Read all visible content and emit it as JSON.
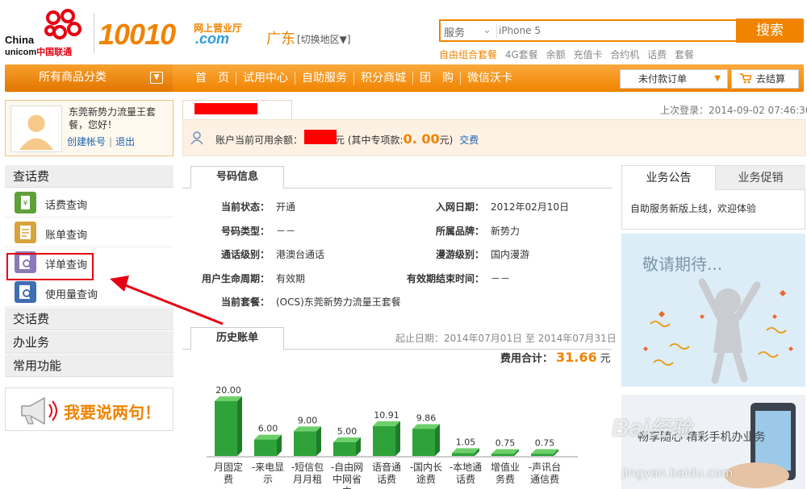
{
  "header": {
    "logo_text_1": "China",
    "logo_text_2a": "unicom",
    "logo_text_2b": "中国联通",
    "brand_number": "10010",
    "brand_hall": "网上营业厅",
    "brand_com": ".com",
    "region": "广东",
    "region_switch": "[切换地区▼]",
    "search": {
      "category": "服务",
      "placeholder": "iPhone 5",
      "button": "搜索",
      "hot_links": [
        "自由组合套餐",
        "4G套餐",
        "余额",
        "充值卡",
        "合约机",
        "话费",
        "套餐"
      ]
    }
  },
  "nav": {
    "all_categories": "所有商品分类",
    "items": [
      "首　页",
      "试用中心",
      "自助服务",
      "积分商城",
      "团　购",
      "微信沃卡"
    ],
    "unpaid_orders": "未付款订单",
    "checkout": "去结算"
  },
  "user": {
    "name": "东莞新势力流量王套餐，您好！",
    "create_account": "创建帐号",
    "logout": "退出"
  },
  "sidebar": {
    "sections": [
      {
        "title": "查话费",
        "items": [
          "话费查询",
          "账单查询",
          "详单查询",
          "使用量查询"
        ]
      },
      {
        "title": "交话费"
      },
      {
        "title": "办业务"
      },
      {
        "title": "常用功能"
      }
    ],
    "speak": "我要说两句！"
  },
  "account": {
    "last_login": "上次登录：2014-09-02 07:46:30",
    "balance_prefix": "账户当前可用余额：",
    "balance_suffix": "元 (其中专项款:",
    "special_amount": "0. 00",
    "balance_end": "元)",
    "pay_link": "交费"
  },
  "number_info": {
    "tab": "号码信息",
    "rows": [
      {
        "k": "当前状态：",
        "v": "开通"
      },
      {
        "k": "入网日期：",
        "v": "2012年02月10日"
      },
      {
        "k": "号码类型：",
        "v": "－－"
      },
      {
        "k": "所属品牌：",
        "v": "新势力"
      },
      {
        "k": "通话级别：",
        "v": "港澳台通话"
      },
      {
        "k": "漫游级别：",
        "v": "国内漫游"
      },
      {
        "k": "用户生命周期：",
        "v": "有效期"
      },
      {
        "k": "有效期结束时间：",
        "v": "－－"
      },
      {
        "k": "当前套餐：",
        "v": "(OCS)东莞新势力流量王套餐"
      }
    ]
  },
  "bill_history": {
    "tab": "历史账单",
    "period": "起止日期：2014年07月01日 至 2014年07月31日",
    "total_label": "费用合计：",
    "total_amount": "31.66",
    "total_unit": "元"
  },
  "chart_data": {
    "type": "bar",
    "categories": [
      "月固定费",
      "-来电显示",
      "-短信包月月租",
      "-自由网中网省内",
      "语音通话费",
      "-国内长途费",
      "-本地通话费",
      "增值业务费",
      "-声讯台通信费"
    ],
    "category_lines": [
      [
        "月固定",
        "费"
      ],
      [
        "-来电显",
        "示"
      ],
      [
        "-短信包",
        "月月租"
      ],
      [
        "-自由网",
        "中网省",
        "内"
      ],
      [
        "语音通",
        "话费"
      ],
      [
        "-国内长",
        "途费"
      ],
      [
        "-本地通",
        "话费"
      ],
      [
        "增值业",
        "务费"
      ],
      [
        "-声讯台",
        "通信费"
      ]
    ],
    "values": [
      20.0,
      6.0,
      9.0,
      5.0,
      10.91,
      9.86,
      1.05,
      0.75,
      0.75
    ],
    "value_labels": [
      "20.00",
      "6.00",
      "9.00",
      "5.00",
      "10.91",
      "9.86",
      "1.05",
      "0.75",
      "0.75"
    ],
    "ylim": [
      0,
      20
    ],
    "bar_color": "#2fa33a"
  },
  "right": {
    "tab_notice": "业务公告",
    "tab_promo": "业务促销",
    "notice": "自助服务新版上线，欢迎体验",
    "banner1": "敬请期待...",
    "banner2": "畅享随心 精彩手机办业务",
    "watermark": "Bai",
    "watermark_jy": "经验",
    "watermark_url": "jingyan.baidu.com"
  },
  "colors": {
    "accent": "#f08300",
    "link": "#1a63b3",
    "highlight": "#e60012"
  }
}
